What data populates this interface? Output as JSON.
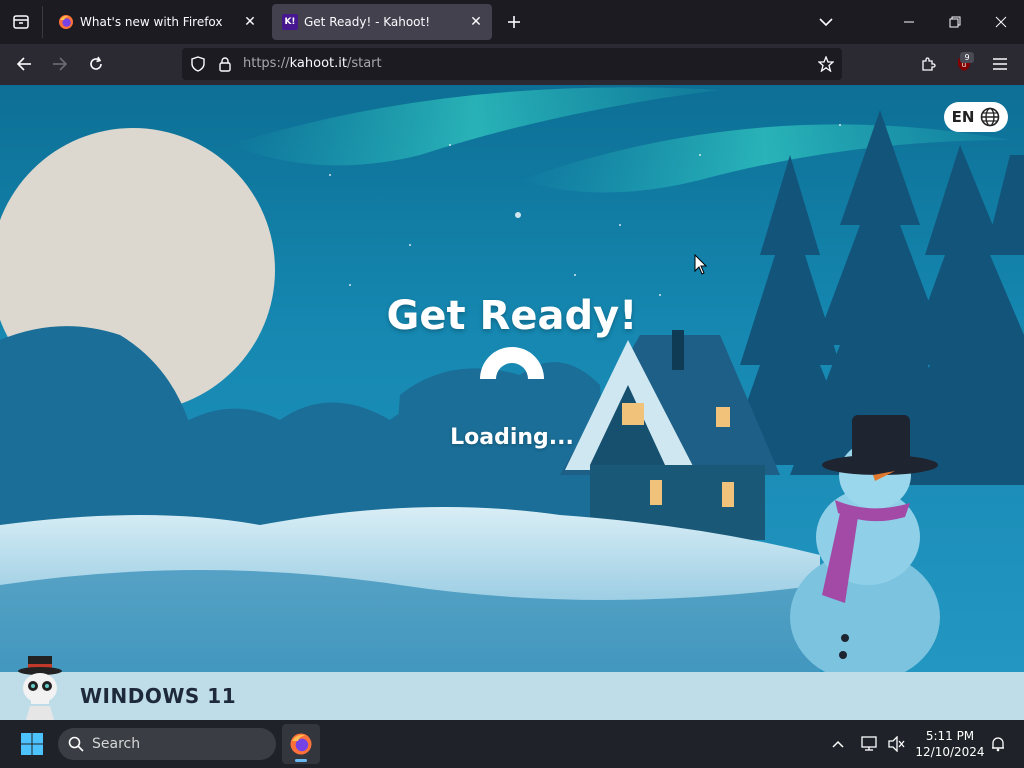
{
  "browser": {
    "tabs": [
      {
        "title": "What's new with Firefox",
        "active": false
      },
      {
        "title": "Get Ready! - Kahoot!",
        "active": true
      }
    ],
    "favicon_kahoot_text": "K!",
    "url_prefix": "https://",
    "url_host": "kahoot.it",
    "url_path": "/start",
    "extension_badge": "9"
  },
  "page": {
    "language_button": "EN",
    "headline": "Get Ready!",
    "loading_text": "Loading..."
  },
  "watermark": {
    "label": "WINDOWS 11"
  },
  "taskbar": {
    "search_label": "Search",
    "time": "5:11 PM",
    "date": "12/10/2024"
  },
  "colors": {
    "tab_active": "#42414d",
    "toolbar": "#2b2a33",
    "sky": "#1587b0",
    "taskbar": "#1f2228",
    "watermark_bg": "#bfdde8"
  }
}
